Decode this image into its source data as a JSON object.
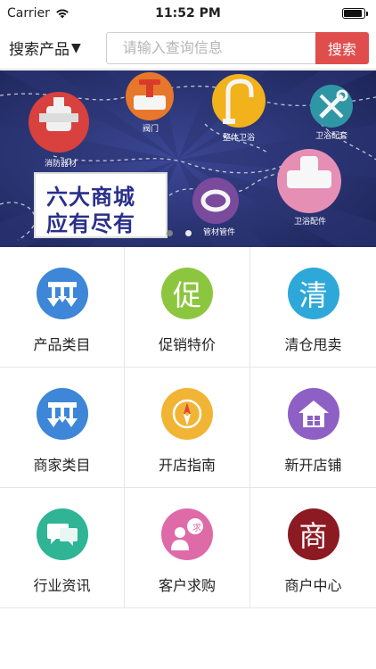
{
  "status_bar": {
    "carrier": "Carrier",
    "time": "11:52 PM",
    "battery_level": 0.95
  },
  "search": {
    "dropdown_label": "搜索产品",
    "dropdown_arrow": "▼",
    "placeholder": "请输入查询信息",
    "button_label": "搜索"
  },
  "banner": {
    "categories": [
      "消防器材",
      "阀门",
      "整体卫浴",
      "卫浴配套",
      "管材管件",
      "卫浴配件"
    ],
    "promo_line1": "六大商城",
    "promo_line2": "应有尽有",
    "slide_count": 2,
    "active_slide": 1,
    "colors": {
      "background": "#26306a",
      "accent_red": "#d8413d",
      "accent_orange": "#e7772b",
      "accent_yellow": "#f2b21b",
      "accent_teal": "#2f96a6",
      "accent_pink": "#e68fb5",
      "accent_purple": "#7a4a9c"
    }
  },
  "grid": {
    "items": [
      {
        "label": "产品类目",
        "icon": "arrows-down-icon",
        "glyph": "",
        "color": "#3d86d8"
      },
      {
        "label": "促销特价",
        "icon": "promo-char-icon",
        "glyph": "促",
        "color": "#8cc63f"
      },
      {
        "label": "清仓甩卖",
        "icon": "clearance-char-icon",
        "glyph": "清",
        "color": "#2ea8d8"
      },
      {
        "label": "商家类目",
        "icon": "arrows-down-icon",
        "glyph": "",
        "color": "#3d86d8"
      },
      {
        "label": "开店指南",
        "icon": "compass-icon",
        "glyph": "",
        "color": "#f1b434"
      },
      {
        "label": "新开店铺",
        "icon": "house-icon",
        "glyph": "",
        "color": "#8e5fc4"
      },
      {
        "label": "行业资讯",
        "icon": "chat-bubbles-icon",
        "glyph": "",
        "color": "#2fb496"
      },
      {
        "label": "客户求购",
        "icon": "customer-request-icon",
        "glyph": "求",
        "color": "#df6aa8"
      },
      {
        "label": "商户中心",
        "icon": "merchant-char-icon",
        "glyph": "商",
        "color": "#8b1a22"
      }
    ]
  }
}
